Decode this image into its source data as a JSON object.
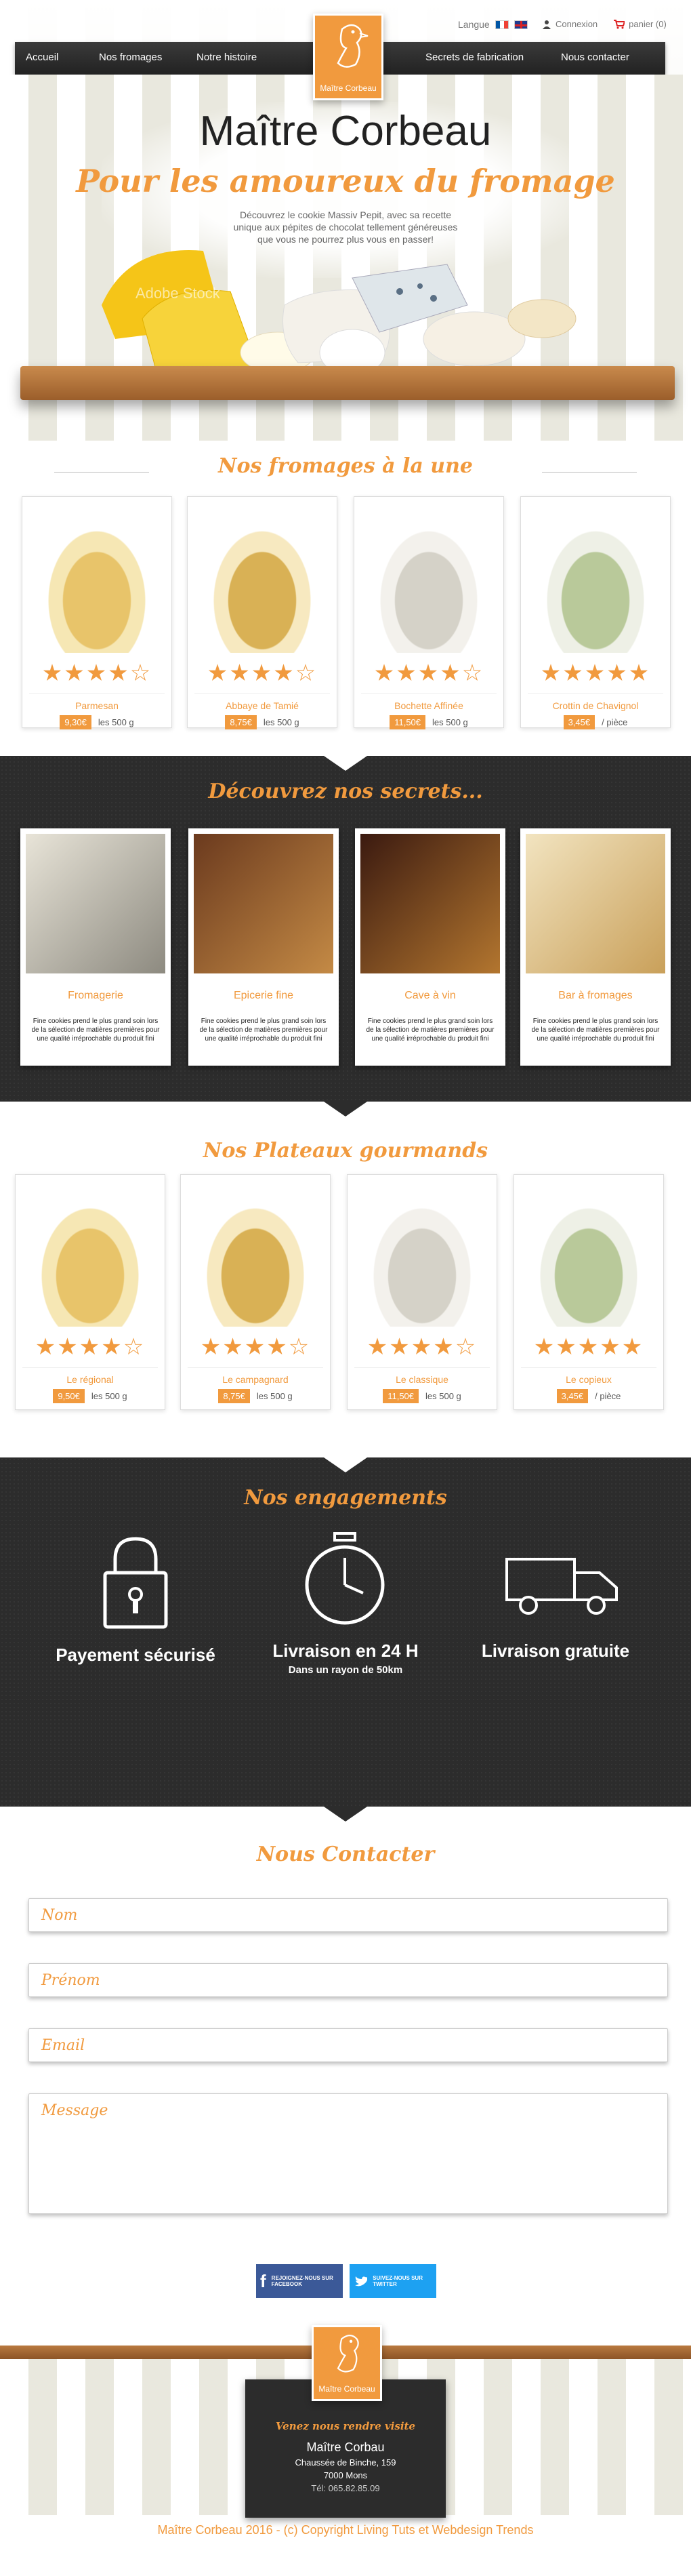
{
  "header": {
    "language_label": "Langue",
    "login_label": "Connexion",
    "cart_label": "panier (0)",
    "logo_caption": "Maître Corbeau",
    "nav": [
      "Accueil",
      "Nos fromages",
      "Notre histoire",
      "Secrets de fabrication",
      "Nous contacter"
    ]
  },
  "hero": {
    "title": "Maître Corbeau",
    "tagline": "Pour les amoureux du fromage",
    "description": "Découvrez le cookie Massiv Pepit, avec sa recette unique aux pépites de chocolat tellement généreuses que vous ne pourrez plus vous en passer!",
    "watermark": "Adobe Stock"
  },
  "featured": {
    "title": "Nos fromages à la une",
    "products": [
      {
        "name": "Parmesan",
        "price": "9,30€",
        "unit": "les 500 g",
        "rating": 4
      },
      {
        "name": "Abbaye de Tamié",
        "price": "8,75€",
        "unit": "les 500 g",
        "rating": 4
      },
      {
        "name": "Bochette Affinée",
        "price": "11,50€",
        "unit": "les 500 g",
        "rating": 4
      },
      {
        "name": "Crottin de Chavignol",
        "price": "3,45€",
        "unit": "/ pièce",
        "rating": 5
      }
    ]
  },
  "secrets": {
    "title": "Découvrez nos secrets...",
    "items": [
      {
        "name": "Fromagerie",
        "text": "Fine cookies prend le plus grand soin lors de la sélection de matières premières pour une qualité irréprochable du produit fini"
      },
      {
        "name": "Epicerie fine",
        "text": "Fine cookies prend le plus grand soin lors de la sélection de matières premières pour une qualité irréprochable du produit fini"
      },
      {
        "name": "Cave à vin",
        "text": "Fine cookies prend le plus grand soin lors de la sélection de matières premières pour une qualité irréprochable du produit fini"
      },
      {
        "name": "Bar à fromages",
        "text": "Fine cookies prend le plus grand soin lors de la sélection de matières premières pour une qualité irréprochable du produit fini"
      }
    ]
  },
  "platters": {
    "title": "Nos Plateaux gourmands",
    "products": [
      {
        "name": "Le régional",
        "price": "9,50€",
        "unit": "les 500 g",
        "rating": 4
      },
      {
        "name": "Le campagnard",
        "price": "8,75€",
        "unit": "les 500 g",
        "rating": 4
      },
      {
        "name": "Le classique",
        "price": "11,50€",
        "unit": "les 500 g",
        "rating": 4
      },
      {
        "name": "Le copieux",
        "price": "3,45€",
        "unit": "/ pièce",
        "rating": 5
      }
    ]
  },
  "commitments": {
    "title": "Nos engagements",
    "items": [
      {
        "title": "Payement sécurisé",
        "sub": "",
        "icon": "padlock-icon"
      },
      {
        "title": "Livraison en 24 H",
        "sub": "Dans un rayon de 50km",
        "icon": "stopwatch-icon"
      },
      {
        "title": "Livraison gratuite",
        "sub": "",
        "icon": "truck-icon"
      }
    ]
  },
  "contact": {
    "title": "Nous Contacter",
    "fields": {
      "name": "Nom",
      "firstname": "Prénom",
      "email": "Email",
      "message": "Message"
    },
    "facebook": "REJOIGNEZ-NOUS SUR FACEBOOK",
    "twitter": "SUIVEZ-NOUS SUR TWITTER"
  },
  "footer": {
    "logo_caption": "Maître Corbeau",
    "visit_title": "Venez nous rendre visite",
    "address_name": "Maître Corbau",
    "street": "Chaussée de Binche, 159",
    "city": "7000 Mons",
    "phone": "Tél: 065.82.85.09",
    "copyright": "Maître Corbeau 2016 - (c) Copyright Living Tuts et Webdesign Trends"
  },
  "colors": {
    "accent": "#f19a3e",
    "dark": "#2c2c2c",
    "nav": "#2a2a2a"
  }
}
